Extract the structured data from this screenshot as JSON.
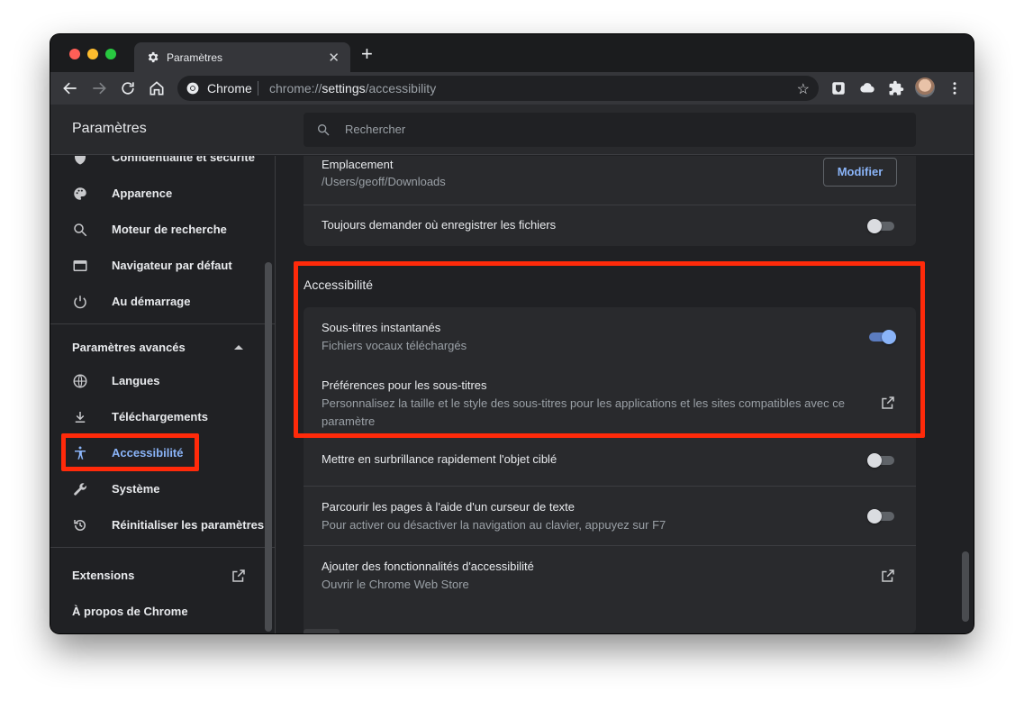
{
  "browser": {
    "tab_title": "Paramètres",
    "new_tab_label": "+",
    "tab_close": "✕",
    "omnibox": {
      "chip": "Chrome",
      "url_prefix": "chrome://",
      "url_bold": "settings",
      "url_suffix": "/accessibility"
    }
  },
  "header": {
    "title": "Paramètres",
    "search_placeholder": "Rechercher"
  },
  "sidebar": {
    "items": [
      {
        "label": "Confidentialité et sécurité",
        "icon": "shield-icon"
      },
      {
        "label": "Apparence",
        "icon": "palette-icon"
      },
      {
        "label": "Moteur de recherche",
        "icon": "search-icon"
      },
      {
        "label": "Navigateur par défaut",
        "icon": "browser-window-icon"
      },
      {
        "label": "Au démarrage",
        "icon": "power-icon"
      }
    ],
    "advanced_label": "Paramètres avancés",
    "advanced_items": [
      {
        "label": "Langues",
        "icon": "globe-icon"
      },
      {
        "label": "Téléchargements",
        "icon": "download-icon"
      },
      {
        "label": "Accessibilité",
        "icon": "accessibility-icon",
        "active": true
      },
      {
        "label": "Système",
        "icon": "wrench-icon"
      },
      {
        "label": "Réinitialiser les paramètres",
        "icon": "history-icon"
      }
    ],
    "extensions_label": "Extensions",
    "about_label": "À propos de Chrome"
  },
  "downloads": {
    "location_title": "Emplacement",
    "location_path": "/Users/geoff/Downloads",
    "modify_button": "Modifier",
    "always_ask": "Toujours demander où enregistrer les fichiers",
    "always_ask_on": false
  },
  "accessibility": {
    "section_title": "Accessibilité",
    "live_caption_title": "Sous-titres instantanés",
    "live_caption_sub": "Fichiers vocaux téléchargés",
    "live_caption_on": true,
    "caption_prefs_title": "Préférences pour les sous-titres",
    "caption_prefs_sub": "Personnalisez la taille et le style des sous-titres pour les applications et les sites compatibles avec ce paramètre",
    "focus_highlight": "Mettre en surbrillance rapidement l'objet ciblé",
    "focus_highlight_on": false,
    "caret_title": "Parcourir les pages à l'aide d'un curseur de texte",
    "caret_sub": "Pour activer ou désactiver la navigation au clavier, appuyez sur F7",
    "caret_on": false,
    "add_features_title": "Ajouter des fonctionnalités d'accessibilité",
    "add_features_sub": "Ouvrir le Chrome Web Store"
  },
  "colors": {
    "accent": "#8ab4f8",
    "highlight": "#ff2a0a",
    "background": "#202124",
    "card": "#292a2d"
  }
}
